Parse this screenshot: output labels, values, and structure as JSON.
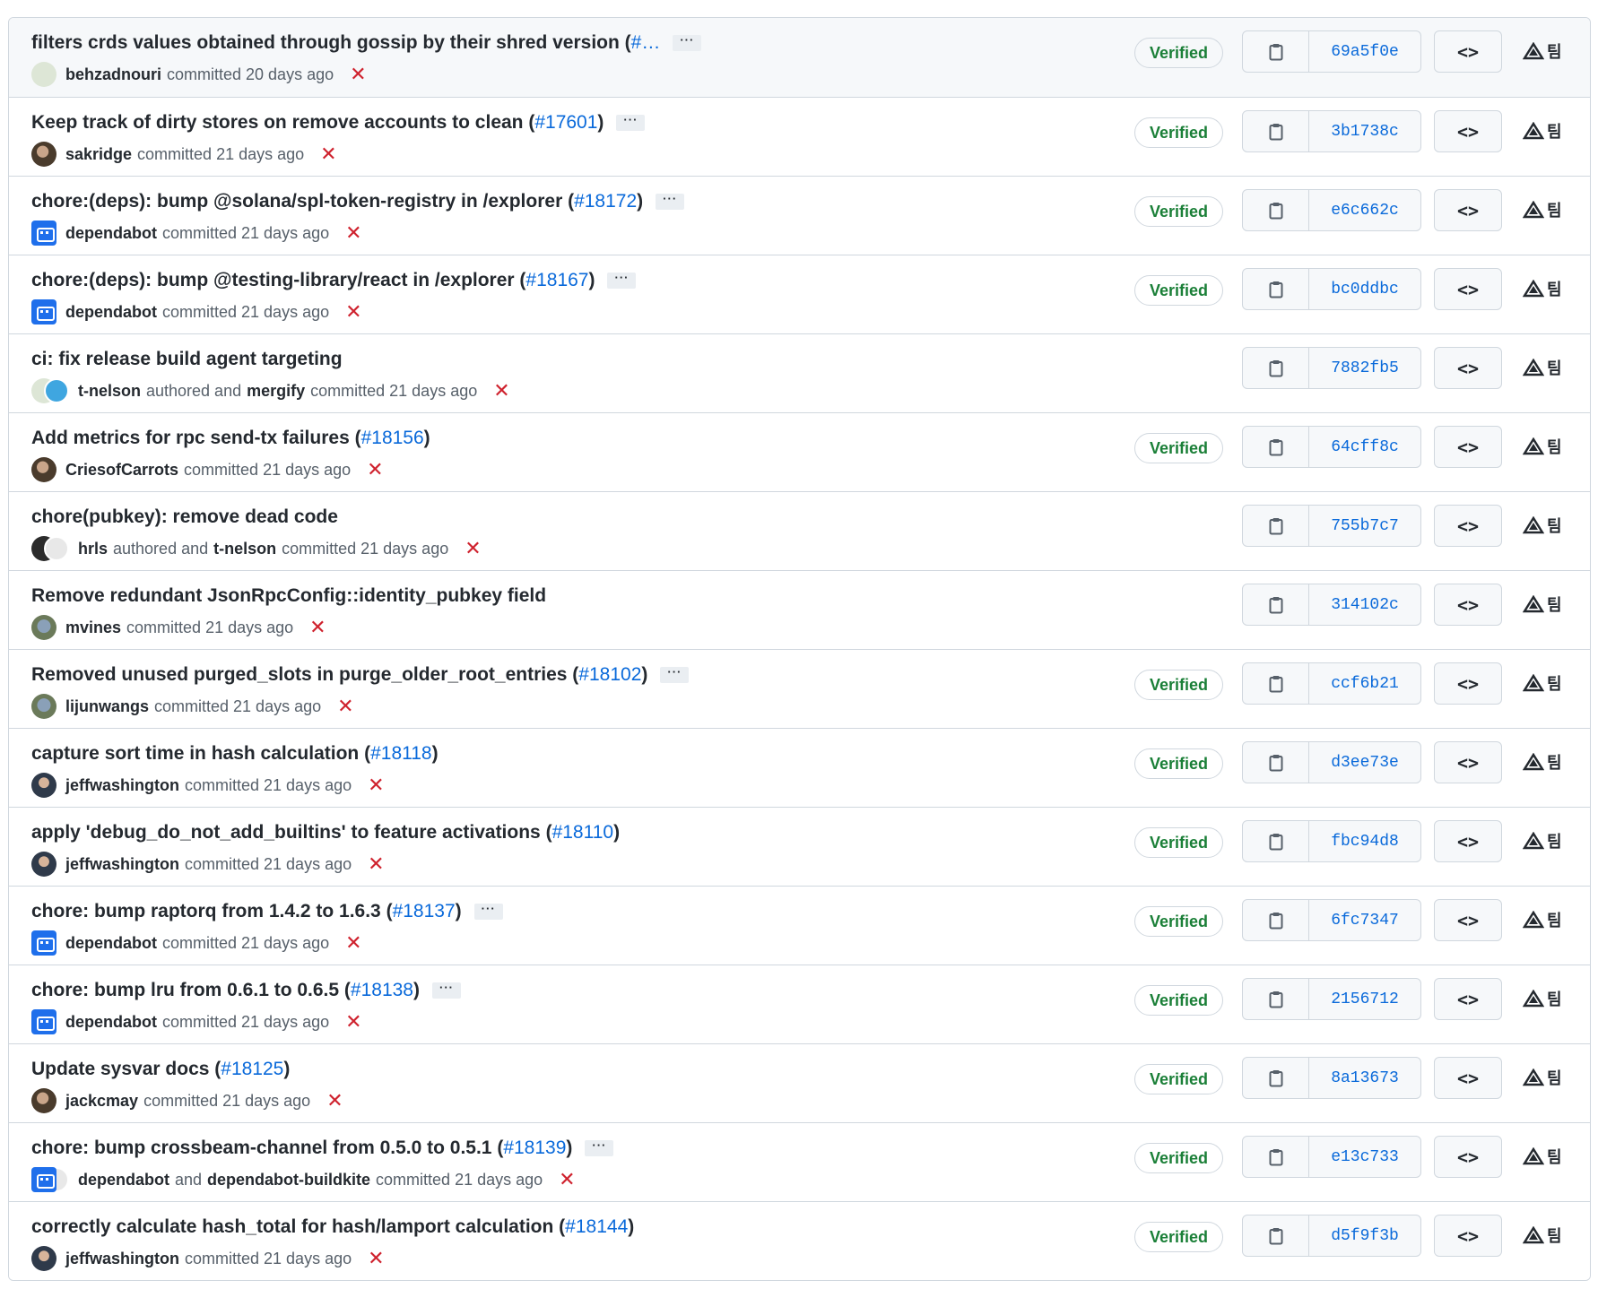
{
  "verified_label": "Verified",
  "ellipsis": "···",
  "commits": [
    {
      "title": "filters crds values obtained through gossip by their shred version (",
      "pr": "#…",
      "close": "",
      "ellipsis": true,
      "verified": true,
      "sha": "69a5f0e",
      "avatars": [
        "ghost"
      ],
      "authors": [
        "behzadnouri"
      ],
      "text1": "",
      "text2": "committed 20 days ago"
    },
    {
      "title": "Keep track of dirty stores on remove accounts to clean (",
      "pr": "#17601",
      "close": ")",
      "ellipsis": true,
      "verified": true,
      "sha": "3b1738c",
      "avatars": [
        "photo"
      ],
      "authors": [
        "sakridge"
      ],
      "text1": "",
      "text2": "committed 21 days ago"
    },
    {
      "title": "chore:(deps): bump @solana/spl-token-registry in /explorer (",
      "pr": "#18172",
      "close": ")",
      "ellipsis": true,
      "verified": true,
      "sha": "e6c662c",
      "avatars": [
        "bot"
      ],
      "authors": [
        "dependabot"
      ],
      "text1": "",
      "text2": "committed 21 days ago"
    },
    {
      "title": "chore:(deps): bump @testing-library/react in /explorer (",
      "pr": "#18167",
      "close": ")",
      "ellipsis": true,
      "verified": true,
      "sha": "bc0ddbc",
      "avatars": [
        "bot"
      ],
      "authors": [
        "dependabot"
      ],
      "text1": "",
      "text2": "committed 21 days ago"
    },
    {
      "title": "ci: fix release build agent targeting",
      "pr": "",
      "close": "",
      "ellipsis": false,
      "verified": false,
      "sha": "7882fb5",
      "avatars": [
        "ghost",
        "mergify"
      ],
      "authors": [
        "t-nelson",
        "mergify"
      ],
      "text1": "authored and",
      "text2": "committed 21 days ago"
    },
    {
      "title": "Add metrics for rpc send-tx failures (",
      "pr": "#18156",
      "close": ")",
      "ellipsis": false,
      "verified": true,
      "sha": "64cff8c",
      "avatars": [
        "photo"
      ],
      "authors": [
        "CriesofCarrots"
      ],
      "text1": "",
      "text2": "committed 21 days ago"
    },
    {
      "title": "chore(pubkey): remove dead code",
      "pr": "",
      "close": "",
      "ellipsis": false,
      "verified": false,
      "sha": "755b7c7",
      "avatars": [
        "dark",
        "light"
      ],
      "authors": [
        "hrls",
        "t-nelson"
      ],
      "text1": "authored and",
      "text2": "committed 21 days ago"
    },
    {
      "title": "Remove redundant JsonRpcConfig::identity_pubkey field",
      "pr": "",
      "close": "",
      "ellipsis": false,
      "verified": false,
      "sha": "314102c",
      "avatars": [
        "photo3"
      ],
      "authors": [
        "mvines"
      ],
      "text1": "",
      "text2": "committed 21 days ago"
    },
    {
      "title": "Removed unused purged_slots in purge_older_root_entries (",
      "pr": "#18102",
      "close": ")",
      "ellipsis": true,
      "verified": true,
      "sha": "ccf6b21",
      "avatars": [
        "photo3"
      ],
      "authors": [
        "lijunwangs"
      ],
      "text1": "",
      "text2": "committed 21 days ago"
    },
    {
      "title": "capture sort time in hash calculation (",
      "pr": "#18118",
      "close": ")",
      "ellipsis": false,
      "verified": true,
      "sha": "d3ee73e",
      "avatars": [
        "photo2"
      ],
      "authors": [
        "jeffwashington"
      ],
      "text1": "",
      "text2": "committed 21 days ago"
    },
    {
      "title": "apply 'debug_do_not_add_builtins' to feature activations (",
      "pr": "#18110",
      "close": ")",
      "ellipsis": false,
      "verified": true,
      "sha": "fbc94d8",
      "avatars": [
        "photo2"
      ],
      "authors": [
        "jeffwashington"
      ],
      "text1": "",
      "text2": "committed 21 days ago"
    },
    {
      "title": "chore: bump raptorq from 1.4.2 to 1.6.3 (",
      "pr": "#18137",
      "close": ")",
      "ellipsis": true,
      "verified": true,
      "sha": "6fc7347",
      "avatars": [
        "bot"
      ],
      "authors": [
        "dependabot"
      ],
      "text1": "",
      "text2": "committed 21 days ago"
    },
    {
      "title": "chore: bump lru from 0.6.1 to 0.6.5 (",
      "pr": "#18138",
      "close": ")",
      "ellipsis": true,
      "verified": true,
      "sha": "2156712",
      "avatars": [
        "bot"
      ],
      "authors": [
        "dependabot"
      ],
      "text1": "",
      "text2": "committed 21 days ago"
    },
    {
      "title": "Update sysvar docs (",
      "pr": "#18125",
      "close": ")",
      "ellipsis": false,
      "verified": true,
      "sha": "8a13673",
      "avatars": [
        "photo"
      ],
      "authors": [
        "jackcmay"
      ],
      "text1": "",
      "text2": "committed 21 days ago"
    },
    {
      "title": "chore: bump crossbeam-channel from 0.5.0 to 0.5.1 (",
      "pr": "#18139",
      "close": ")",
      "ellipsis": true,
      "verified": true,
      "sha": "e13c733",
      "avatars": [
        "bot",
        "light"
      ],
      "authors": [
        "dependabot",
        "dependabot-buildkite"
      ],
      "text1": "and",
      "text2": "committed 21 days ago"
    },
    {
      "title": "correctly calculate hash_total for hash/lamport calculation (",
      "pr": "#18144",
      "close": ")",
      "ellipsis": false,
      "verified": true,
      "sha": "d5f9f3b",
      "avatars": [
        "photo2"
      ],
      "authors": [
        "jeffwashington"
      ],
      "text1": "",
      "text2": "committed 21 days ago"
    }
  ],
  "icons": {
    "copy": "clipboard-icon",
    "code": "code-icon",
    "x": "x-icon",
    "tri": "triangle-icon"
  },
  "colors": {
    "verified": "#1a7f37",
    "link": "#0969da",
    "fail": "#cf222e"
  }
}
